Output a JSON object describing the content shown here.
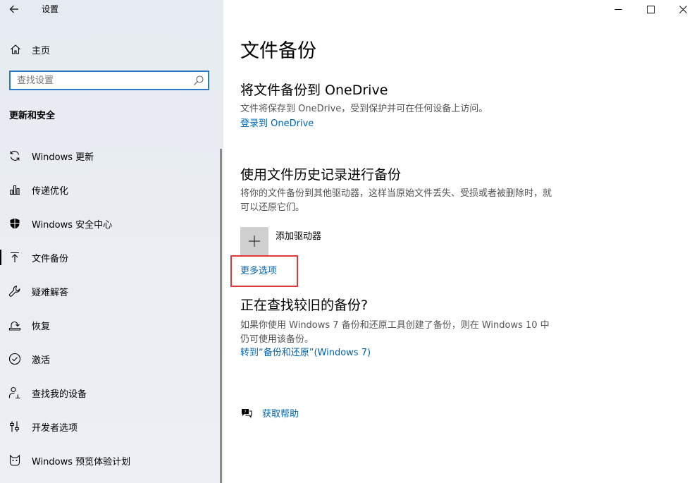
{
  "window": {
    "title": "设置"
  },
  "sidebar": {
    "home_label": "主页",
    "search_placeholder": "查找设置",
    "section_title": "更新和安全",
    "items": [
      {
        "label": "Windows 更新",
        "icon": "refresh-icon"
      },
      {
        "label": "传递优化",
        "icon": "delivery-optimization-icon"
      },
      {
        "label": "Windows 安全中心",
        "icon": "shield-icon"
      },
      {
        "label": "文件备份",
        "icon": "backup-arrow-icon",
        "selected": true
      },
      {
        "label": "疑难解答",
        "icon": "wrench-icon"
      },
      {
        "label": "恢复",
        "icon": "recovery-icon"
      },
      {
        "label": "激活",
        "icon": "check-circle-icon"
      },
      {
        "label": "查找我的设备",
        "icon": "person-locate-icon"
      },
      {
        "label": "开发者选项",
        "icon": "developer-icon"
      },
      {
        "label": "Windows 预览体验计划",
        "icon": "insider-cat-icon"
      }
    ]
  },
  "main": {
    "page_title": "文件备份",
    "onedrive": {
      "heading": "将文件备份到 OneDrive",
      "description": "文件将保存到 OneDrive，受到保护并可在任何设备上访问。",
      "link": "登录到 OneDrive"
    },
    "file_history": {
      "heading": "使用文件历史记录进行备份",
      "description": "将你的文件备份到其他驱动器，这样当原始文件丢失、受损或者被删除时，就可以还原它们。",
      "add_drive_label": "添加驱动器",
      "more_options_link": "更多选项"
    },
    "older_backup": {
      "heading": "正在查找较旧的备份?",
      "description": "如果你使用 Windows 7 备份和还原工具创建了备份，则在 Windows 10 中仍可使用该备份。",
      "link": "转到“备份和还原”(Windows 7)"
    },
    "help_link": "获取帮助"
  },
  "colors": {
    "accent": "#0063b1",
    "highlight": "#e0393c",
    "search_border": "#2b79c2"
  }
}
